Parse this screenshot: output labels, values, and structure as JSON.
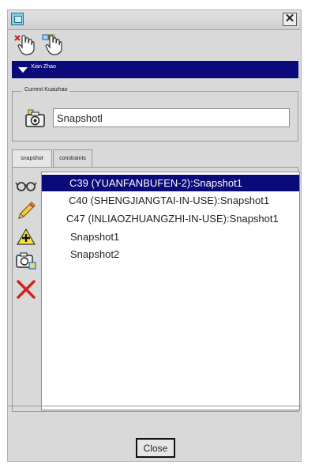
{
  "window": {
    "title": ""
  },
  "titlebar": {
    "close_glyph": "✕"
  },
  "toolbar": {
    "buttons": [
      {
        "icon": "delete-pick-icon"
      },
      {
        "icon": "pick-icon"
      }
    ]
  },
  "section": {
    "label": "Xian Zhao"
  },
  "current_group": {
    "legend": "Current Kuaizhao",
    "input_value": "Snapshotl"
  },
  "tabs": [
    {
      "label": "snapshot",
      "active": true
    },
    {
      "label": "constraints",
      "active": false
    }
  ],
  "side_tools": [
    {
      "icon": "glasses-icon"
    },
    {
      "icon": "pencil-icon"
    },
    {
      "icon": "add-warning-icon"
    },
    {
      "icon": "camera-icon"
    },
    {
      "icon": "delete-icon"
    }
  ],
  "list": {
    "items": [
      {
        "label": "C39 (YUANFANBUFEN-2):Snapshot1",
        "selected": true
      },
      {
        "label": "C40 (SHENGJIANGTAI-IN-USE):Snapshot1",
        "selected": false
      },
      {
        "label": "C47 (INLIAOZHUANGZHI-IN-USE):Snapshot1",
        "selected": false
      },
      {
        "label": "Snapshot1",
        "selected": false
      },
      {
        "label": "Snapshot2",
        "selected": false
      }
    ]
  },
  "footer": {
    "close_label": "Close"
  },
  "colors": {
    "selection": "#0a0a7a",
    "window_bg": "#d9d9d9",
    "delete_red": "#d42020"
  }
}
